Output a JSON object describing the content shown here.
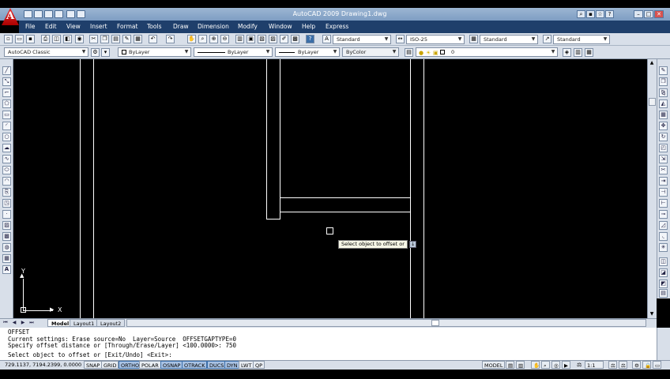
{
  "window": {
    "title": "AutoCAD 2009 Drawing1.dwg",
    "logo_letter": "A"
  },
  "menu": {
    "items": [
      "File",
      "Edit",
      "View",
      "Insert",
      "Format",
      "Tools",
      "Draw",
      "Dimension",
      "Modify",
      "Window",
      "Help",
      "Express"
    ]
  },
  "styles_toolbar": {
    "text_style": "Standard",
    "dim_style": "ISO-25",
    "table_style": "Standard",
    "mleader_style": "Standard"
  },
  "properties_toolbar": {
    "workspace": "AutoCAD Classic",
    "layer_color": "ByLayer",
    "linetype": "ByLayer",
    "lineweight": "ByLayer",
    "plot_style": "ByColor",
    "current_layer": "0"
  },
  "tooltip": {
    "text": "Select object to offset or",
    "arrow": "↓"
  },
  "ucs": {
    "x_label": "X",
    "y_label": "Y"
  },
  "tabs": {
    "items": [
      "Model",
      "Layout1",
      "Layout2"
    ],
    "active": "Model"
  },
  "command_line": {
    "history": [
      "OFFSET",
      "Current settings: Erase source=No  Layer=Source  OFFSETGAPTYPE=0",
      "Specify offset distance or [Through/Erase/Layer] <100.0000>: 750"
    ],
    "prompt": "Select object to offset or [Exit/Undo] <Exit>:"
  },
  "status_bar": {
    "coordinates": "729.1137, 7194.2399, 0.0000",
    "toggles": [
      {
        "label": "SNAP",
        "on": false
      },
      {
        "label": "GRID",
        "on": false
      },
      {
        "label": "ORTHO",
        "on": true
      },
      {
        "label": "POLAR",
        "on": false
      },
      {
        "label": "OSNAP",
        "on": true
      },
      {
        "label": "OTRACK",
        "on": true
      },
      {
        "label": "DUCS",
        "on": true
      },
      {
        "label": "DYN",
        "on": true
      },
      {
        "label": "LWT",
        "on": false
      },
      {
        "label": "QP",
        "on": false
      }
    ],
    "model_label": "MODEL",
    "annotation_scale": "1:1"
  },
  "colors": {
    "title_bar": "#8aa7cb",
    "menubar": "#1f3f6b",
    "toolbar": "#d8dfe9",
    "canvas": "#000000",
    "toggle_on": "#a8c2e4"
  }
}
